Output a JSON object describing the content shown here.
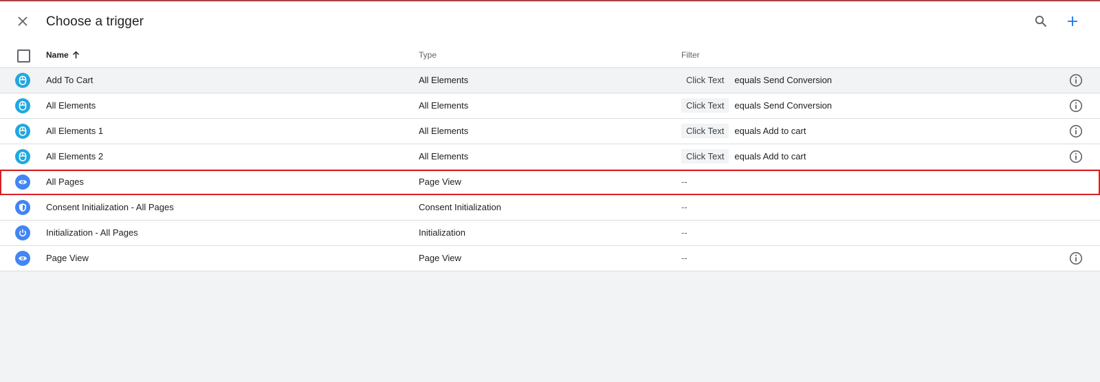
{
  "header": {
    "title": "Choose a trigger",
    "close_icon": "close-icon",
    "search_icon": "search-icon",
    "add_icon": "plus-icon"
  },
  "columns": {
    "name": "Name",
    "type": "Type",
    "filter": "Filter",
    "sort": "arrow-up-icon"
  },
  "colors": {
    "accent_blue": "#1a73e8",
    "click_icon_bg": "#22a7e0",
    "pageview_icon_bg": "#4285f4",
    "highlight_border": "#d61f26"
  },
  "rows": [
    {
      "name": "Add To Cart",
      "type": "All Elements",
      "filter_chip": "Click Text",
      "filter_text": "equals Send Conversion",
      "icon": "mouse-icon",
      "info": true,
      "hover": true
    },
    {
      "name": "All Elements",
      "type": "All Elements",
      "filter_chip": "Click Text",
      "filter_text": "equals Send Conversion",
      "icon": "mouse-icon",
      "info": true
    },
    {
      "name": "All Elements 1",
      "type": "All Elements",
      "filter_chip": "Click Text",
      "filter_text": "equals Add to cart",
      "icon": "mouse-icon",
      "info": true
    },
    {
      "name": "All Elements 2",
      "type": "All Elements",
      "filter_chip": "Click Text",
      "filter_text": "equals Add to cart",
      "icon": "mouse-icon",
      "info": true
    },
    {
      "name": "All Pages",
      "type": "Page View",
      "filter_empty": "--",
      "icon": "eye-icon",
      "info": false,
      "highlighted": true
    },
    {
      "name": "Consent Initialization - All Pages",
      "type": "Consent Initialization",
      "filter_empty": "--",
      "icon": "shield-icon",
      "info": false
    },
    {
      "name": "Initialization - All Pages",
      "type": "Initialization",
      "filter_empty": "--",
      "icon": "power-icon",
      "info": false
    },
    {
      "name": "Page View",
      "type": "Page View",
      "filter_empty": "--",
      "icon": "eye-icon",
      "info": true
    }
  ]
}
